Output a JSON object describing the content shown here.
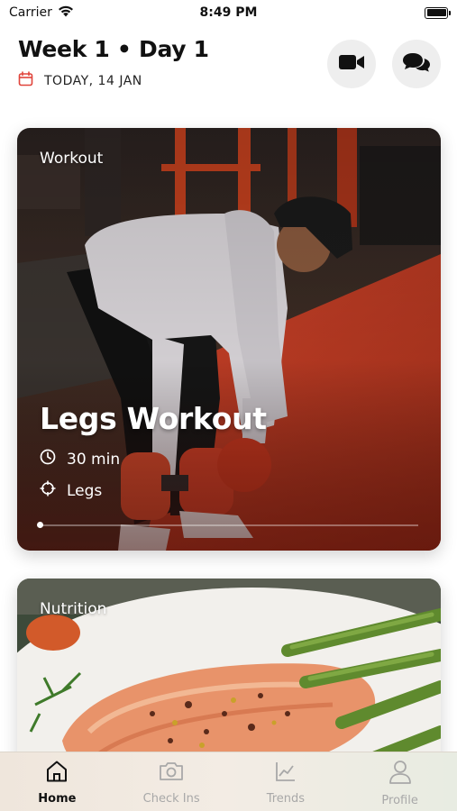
{
  "status_bar": {
    "carrier": "Carrier",
    "time": "8:49 PM"
  },
  "header": {
    "title": "Week 1 • Day 1",
    "date": "TODAY, 14 JAN",
    "actions": [
      {
        "icon": "video-camera-icon"
      },
      {
        "icon": "chat-bubbles-icon"
      }
    ]
  },
  "workout_card": {
    "label": "Workout",
    "title": "Legs Workout",
    "duration": "30 min",
    "target": "Legs",
    "progress": 0
  },
  "nutrition_card": {
    "label": "Nutrition"
  },
  "tab_bar": {
    "tabs": [
      {
        "label": "Home",
        "icon": "home-icon",
        "active": true
      },
      {
        "label": "Check Ins",
        "icon": "camera-icon",
        "active": false
      },
      {
        "label": "Trends",
        "icon": "chart-icon",
        "active": false
      },
      {
        "label": "Profile",
        "icon": "profile-icon",
        "active": false
      }
    ]
  },
  "colors": {
    "accent": "#e0443b",
    "tab_inactive": "#a8a8a8"
  }
}
